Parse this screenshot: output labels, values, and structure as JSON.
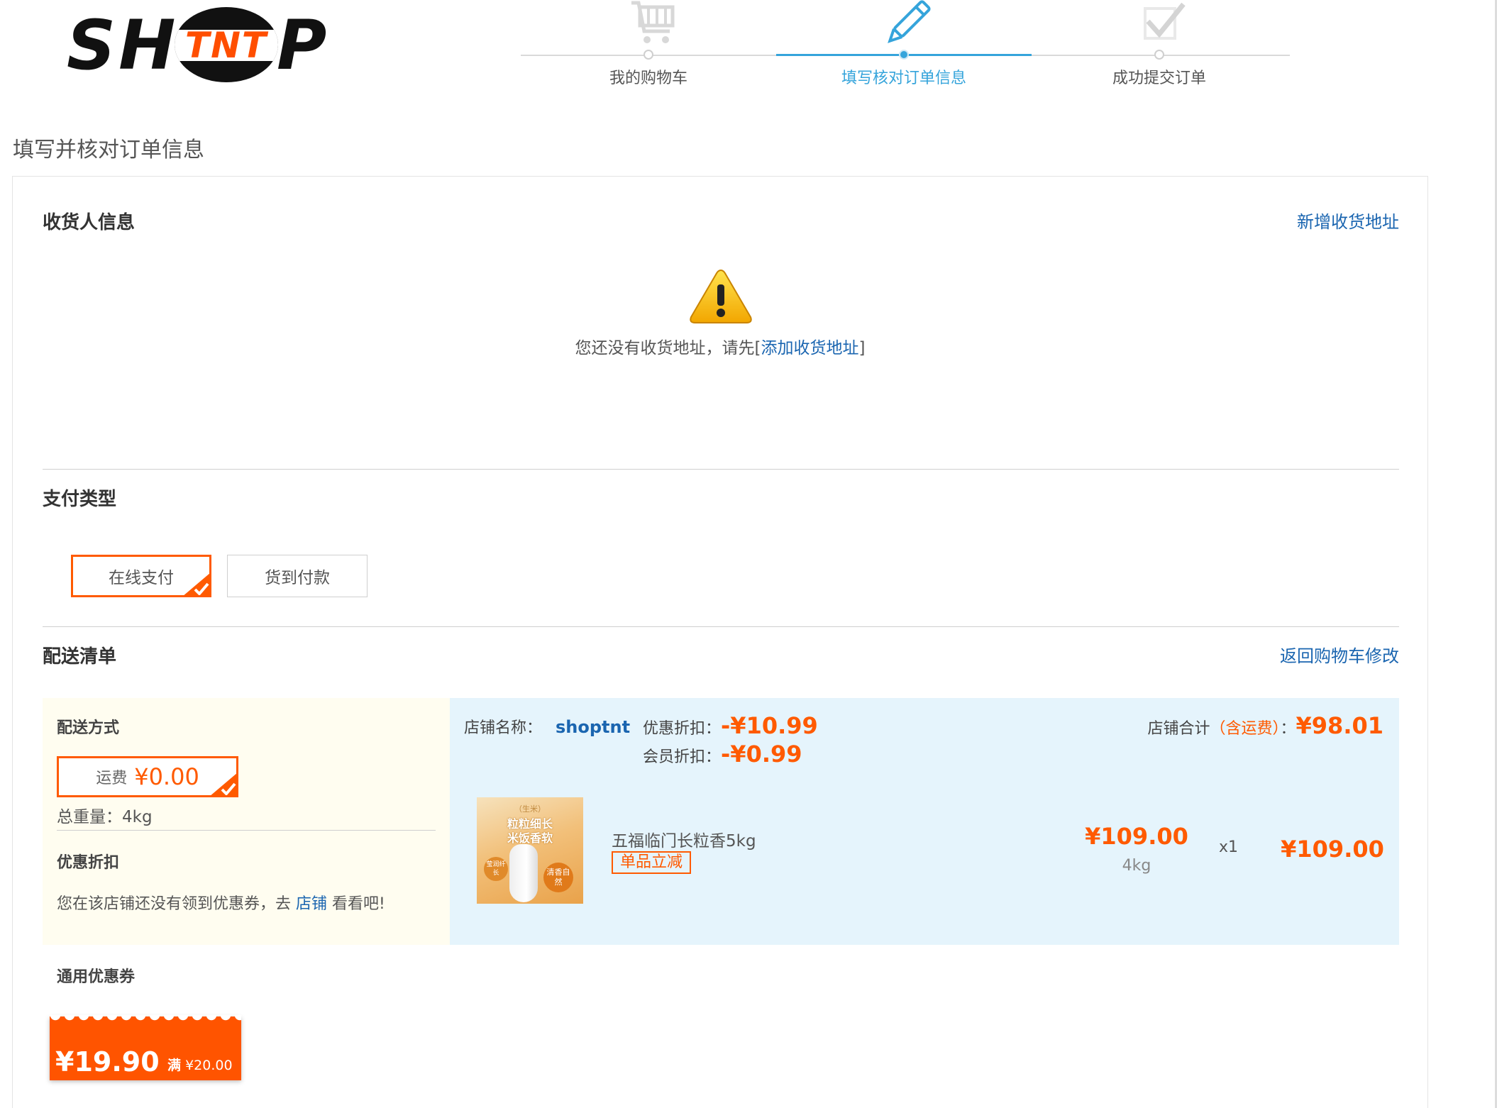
{
  "brand": {
    "left": "SH",
    "middle": "TNT",
    "right": "P"
  },
  "steps": [
    {
      "label": "我的购物车",
      "icon": "cart-icon"
    },
    {
      "label": "填写核对订单信息",
      "icon": "pencil-icon"
    },
    {
      "label": "成功提交订单",
      "icon": "checkmark-icon"
    }
  ],
  "page_title": "填写并核对订单信息",
  "receiver": {
    "title": "收货人信息",
    "add_link": "新增收货地址",
    "empty_prefix": "您还没有收货地址，请先[",
    "empty_link": "添加收货地址",
    "empty_suffix": "]"
  },
  "payment": {
    "title": "支付类型",
    "options": [
      "在线支付",
      "货到付款"
    ],
    "selected": "在线支付"
  },
  "delivery": {
    "title": "配送清单",
    "back_link": "返回购物车修改",
    "method_title": "配送方式",
    "freight_label": "运费",
    "freight_value": "¥0.00",
    "weight_text": "总重量：4kg",
    "discount_title": "优惠折扣",
    "coupon_prefix": "您在该店铺还没有领到优惠券，去",
    "coupon_link": "店铺",
    "coupon_suffix": "看看吧!",
    "shop_label": "店铺名称：",
    "shop_name": "shoptnt",
    "promo_label": "优惠折扣：",
    "promo_value": "-¥10.99",
    "member_label": "会员折扣：",
    "member_value": "-¥0.99",
    "total_label": "店铺合计",
    "total_note": "（含运费）",
    "total_colon": "：",
    "total_value": "¥98.01",
    "product": {
      "name": "五福临门长粒香5kg",
      "tag": "单品立减",
      "unit_price": "¥109.00",
      "unit_weight": "4kg",
      "qty": "x1",
      "subtotal": "¥109.00",
      "img_caption_top": "（生米）",
      "img_caption_1": "粒粒细长",
      "img_caption_2": "米饭香软",
      "img_caption_side": "莹润纤长",
      "img_caption_stamp": "清香自然"
    }
  },
  "general_coupon": {
    "title": "通用优惠券",
    "value": "¥19.90",
    "cond_prefix": "满",
    "cond_value": "¥20.00"
  },
  "colors": {
    "accent": "#ff5a00",
    "link": "#1a65b0",
    "step_active": "#35a4db"
  }
}
